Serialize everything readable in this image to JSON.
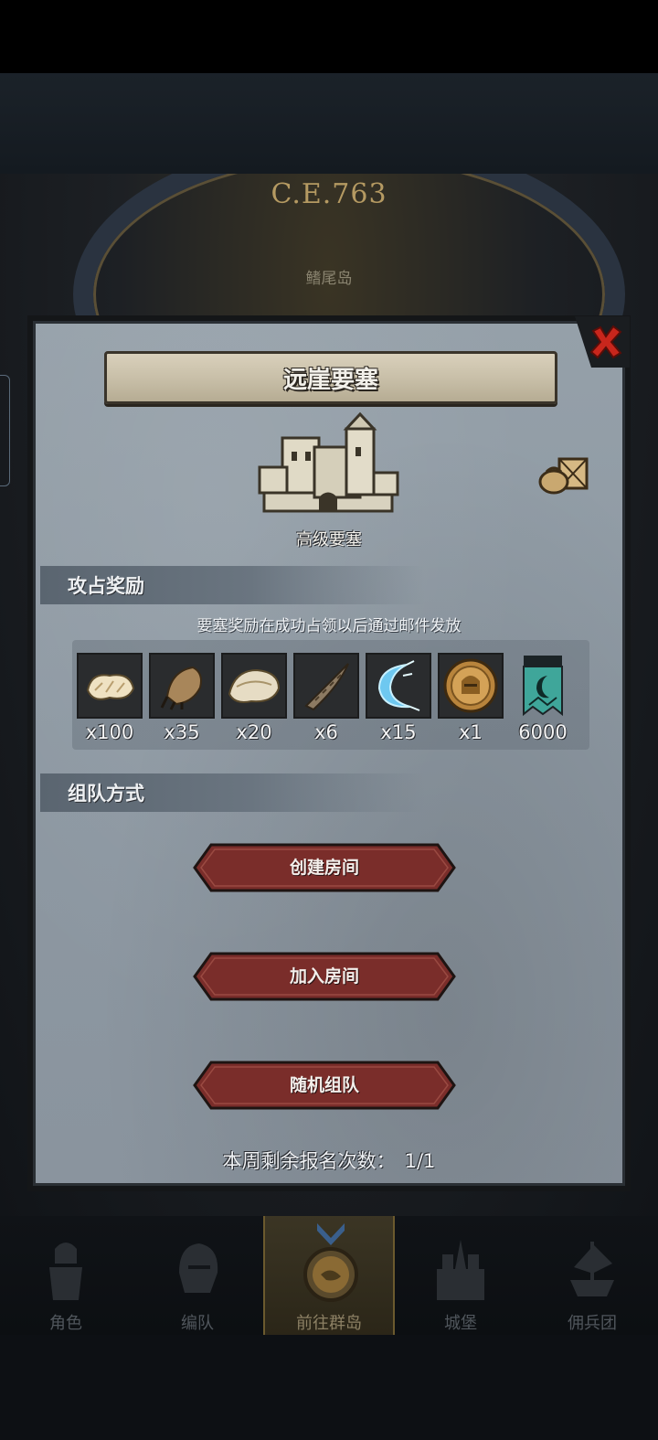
{
  "scene": {
    "era_label": "C.E.763",
    "location_label": "鳍尾岛"
  },
  "dialog": {
    "title": "远崖要塞",
    "fortress_type": "高级要塞",
    "rewards_section": {
      "title": "攻占奖励",
      "note": "要塞奖励在成功占领以后通过邮件发放",
      "items": [
        {
          "icon": "fur-pelt-icon",
          "qty": "x100"
        },
        {
          "icon": "beast-claw-icon",
          "qty": "x35"
        },
        {
          "icon": "hide-scrap-icon",
          "qty": "x20"
        },
        {
          "icon": "twisted-horn-icon",
          "qty": "x6"
        },
        {
          "icon": "frost-crescent-icon",
          "qty": "x15"
        },
        {
          "icon": "knight-helm-coin-icon",
          "qty": "x1"
        },
        {
          "icon": "banner-token-icon",
          "qty": "6000"
        }
      ]
    },
    "team_section": {
      "title": "组队方式",
      "buttons": {
        "create": "创建房间",
        "join": "加入房间",
        "random": "随机组队"
      }
    },
    "signup": {
      "label": "本周剩余报名次数：",
      "value": "1/1"
    }
  },
  "nav": {
    "items": [
      {
        "label": "角色",
        "icon": "knight-icon"
      },
      {
        "label": "编队",
        "icon": "helmet-icon"
      },
      {
        "label": "前往群岛",
        "icon": "island-compass-icon"
      },
      {
        "label": "城堡",
        "icon": "castle-icon"
      },
      {
        "label": "佣兵团",
        "icon": "mercenary-ship-icon"
      }
    ]
  },
  "colors": {
    "panel": "#8d98a2",
    "button": "#7a2d2a",
    "title_plate": "#c7bea7",
    "close": "#c0261e"
  }
}
